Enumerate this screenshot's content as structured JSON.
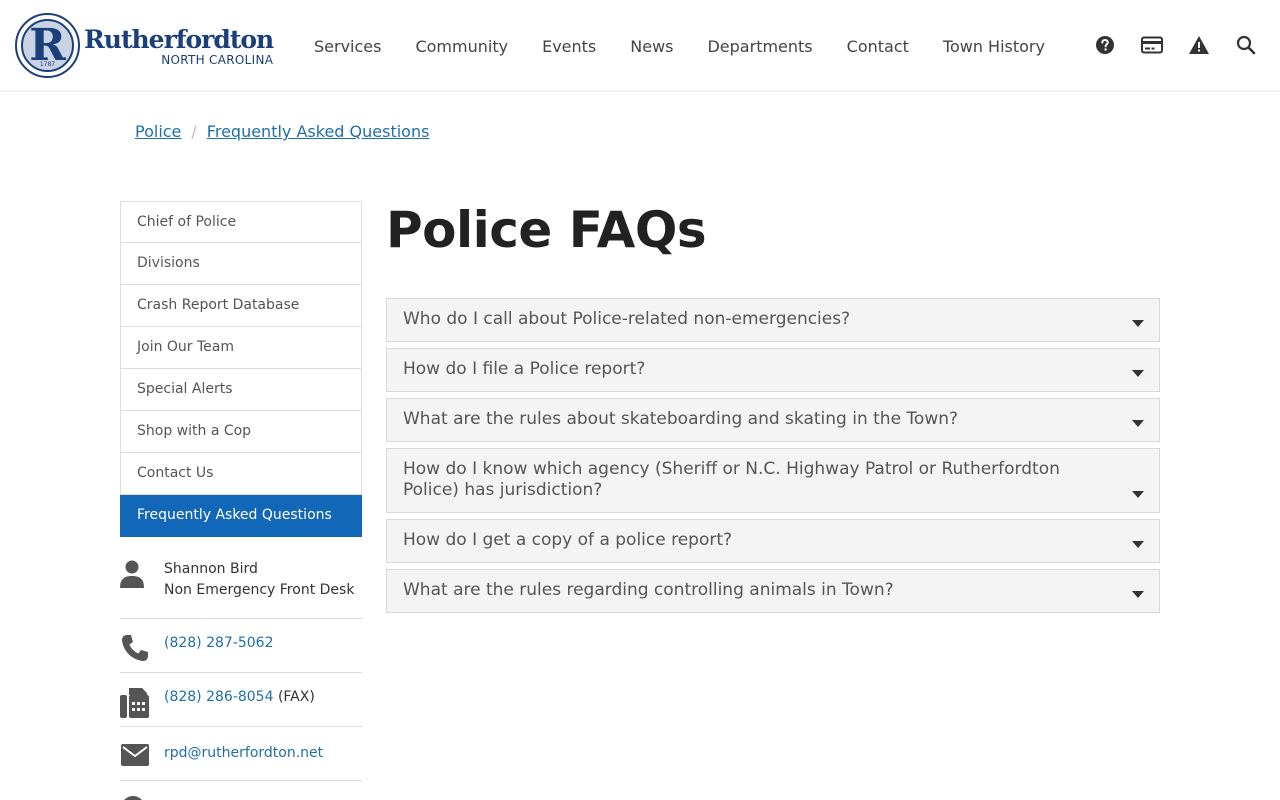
{
  "brand": {
    "name": "Rutherfordton",
    "state": "NORTH CAROLINA",
    "seal_letter": "R",
    "seal_year": "1787",
    "color": "#1b3f7a"
  },
  "nav": {
    "items": [
      "Services",
      "Community",
      "Events",
      "News",
      "Departments",
      "Contact",
      "Town History"
    ]
  },
  "tools": [
    {
      "icon": "help-circle-icon",
      "label": "Help"
    },
    {
      "icon": "credit-card-icon",
      "label": "Pay"
    },
    {
      "icon": "warning-icon",
      "label": "Alerts"
    },
    {
      "icon": "search-icon",
      "label": "Search"
    }
  ],
  "breadcrumb": {
    "items": [
      "Police",
      "Frequently Asked Questions"
    ],
    "separator": "/"
  },
  "sidebar": {
    "items": [
      {
        "label": "Chief of Police",
        "active": false
      },
      {
        "label": "Divisions",
        "active": false
      },
      {
        "label": "Crash Report Database",
        "active": false
      },
      {
        "label": "Join Our Team",
        "active": false
      },
      {
        "label": "Special Alerts",
        "active": false
      },
      {
        "label": "Shop with a Cop",
        "active": false
      },
      {
        "label": "Contact Us",
        "active": false
      },
      {
        "label": "Frequently Asked Questions",
        "active": true
      }
    ],
    "active_color": "#1367b8"
  },
  "contact": {
    "name": "Shannon Bird",
    "role": "Non Emergency Front Desk",
    "phone": "(828) 287-5062",
    "fax": "(828) 286-8054",
    "fax_suffix": "(FAX)",
    "email": "rpd@rutherfordton.net"
  },
  "main": {
    "title": "Police FAQs",
    "faqs": [
      "Who do I call about Police-related non-emergencies?",
      "How do I file a Police report?",
      "What are the rules about skateboarding and skating in the Town?",
      "How do I know which agency (Sheriff or N.C. Highway Patrol or Rutherfordton Police) has jurisdiction?",
      "How do I get a copy of a police report?",
      "What are the rules regarding controlling animals in Town?"
    ]
  },
  "colors": {
    "link": "#1f6fa8",
    "faq_bg": "#f4f4f4"
  }
}
